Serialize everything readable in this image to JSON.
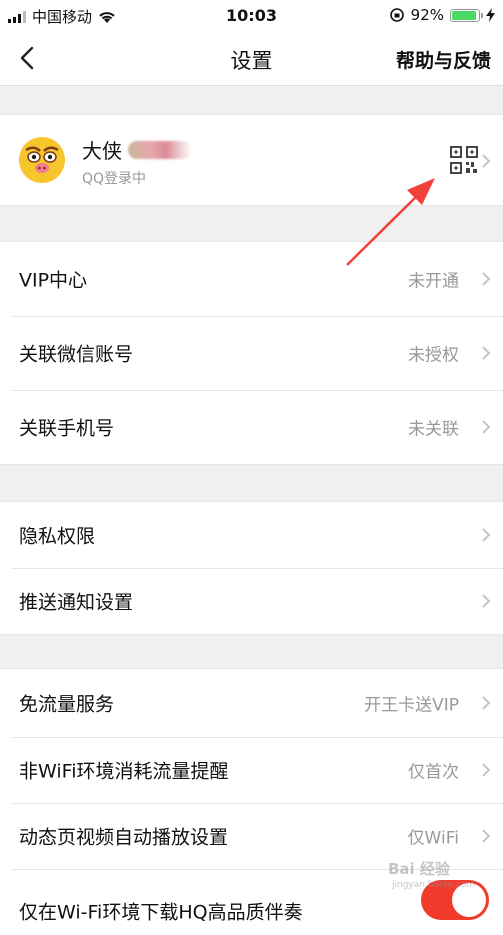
{
  "status_bar": {
    "carrier": "中国移动",
    "time": "10:03",
    "battery": "92%",
    "battery_level": 0.92
  },
  "nav": {
    "title": "设置",
    "right_action": "帮助与反馈"
  },
  "profile": {
    "name": "大侠",
    "status": "QQ登录中"
  },
  "groups": [
    [
      {
        "label": "VIP中心",
        "value": "未开通"
      },
      {
        "label": "关联微信账号",
        "value": "未授权"
      },
      {
        "label": "关联手机号",
        "value": "未关联"
      }
    ],
    [
      {
        "label": "隐私权限",
        "value": ""
      },
      {
        "label": "推送通知设置",
        "value": ""
      }
    ],
    [
      {
        "label": "免流量服务",
        "value": "开王卡送VIP"
      },
      {
        "label": "非WiFi环境消耗流量提醒",
        "value": "仅首次"
      },
      {
        "label": "动态页视频自动播放设置",
        "value": "仅WiFi"
      },
      {
        "label": "仅在Wi-Fi环境下载HQ高品质伴奏",
        "value": ""
      }
    ]
  ],
  "watermark": {
    "main": "Bai 经验",
    "sub": "jingyan.baidu.com"
  },
  "colors": {
    "accent_red": "#f03a2c",
    "battery_green": "#4cd964"
  }
}
